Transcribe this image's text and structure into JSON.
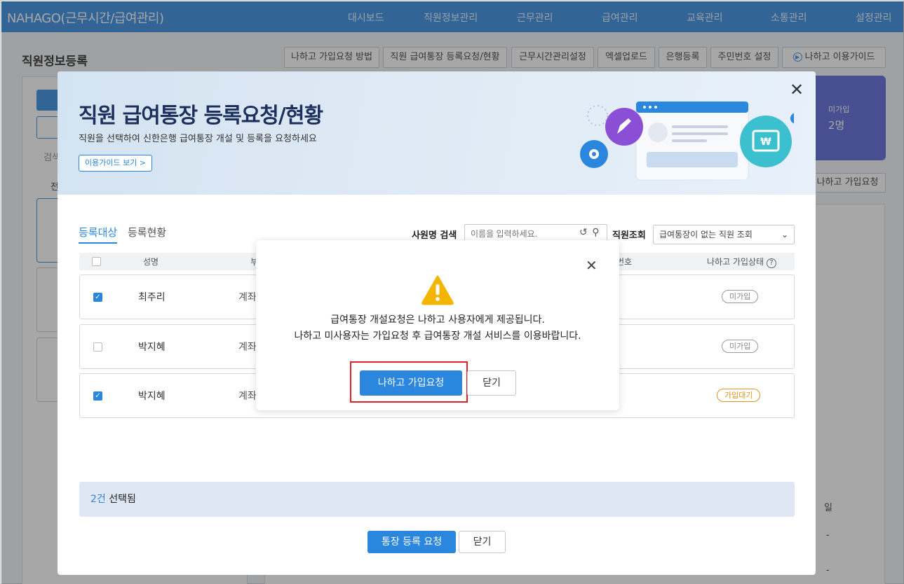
{
  "topnav": {
    "brand": "NAHAGO(근무시간/급여관리)",
    "items": [
      "대시보드",
      "직원정보관리",
      "근무관리",
      "급여관리",
      "교육관리",
      "소통관리",
      "설정관리"
    ]
  },
  "page": {
    "title": "직원정보등록",
    "toolbar": [
      "나하고 가입요청 방법",
      "직원 급여통장 등록요청/현황",
      "근무시간관리설정",
      "엑셀업로드",
      "은행등록",
      "주민번호 설정",
      "나하고 이용가이드"
    ],
    "summary_card": {
      "label": "미가입",
      "count": "2명"
    },
    "side_button": "나하고 가입요청",
    "bg_fragments": [
      "검색",
      "전",
      "일",
      "-",
      "-"
    ]
  },
  "modal": {
    "title": "직원 급여통장 등록요청/현황",
    "subtitle": "직원을 선택하여 신한은행 급여통장 개설 및 등록을 요청하세요",
    "guide_link": "이용가이드 보기 >",
    "tabs": [
      "등록대상",
      "등록현황"
    ],
    "search_label": "사원명 검색",
    "search_placeholder": "이름을 입력하세요.",
    "employee_filter_label": "직원조회",
    "employee_filter_value": "급여통장이 없는 직원 조회",
    "table_headers": {
      "name": "성명",
      "col2": "부",
      "col3": "번호",
      "status": "나하고 가입상태"
    },
    "rows": [
      {
        "checked": true,
        "name": "최주리",
        "account": "계좌",
        "status": "미가입",
        "status_color": "grey"
      },
      {
        "checked": false,
        "name": "박지혜",
        "account": "계좌",
        "status": "미가입",
        "status_color": "grey"
      },
      {
        "checked": true,
        "name": "박지혜",
        "account": "계좌",
        "status": "가입대기",
        "status_color": "orange"
      }
    ],
    "selected_count": "2건",
    "selected_suffix": " 선택됨",
    "submit_label": "통장 등록 요청",
    "close_label": "닫기"
  },
  "alert": {
    "line1": "급여통장 개설요청은 나하고 사용자에게 제공됩니다.",
    "line2": "나하고 미사용자는 가입요청 후 급여통장 개설 서비스를 이용바랍니다.",
    "primary_label": "나하고 가입요청",
    "secondary_label": "닫기"
  },
  "colors": {
    "accent": "#2b86de",
    "warning": "#f5b400",
    "highlight": "#e0202a",
    "summary": "#5160d8"
  }
}
